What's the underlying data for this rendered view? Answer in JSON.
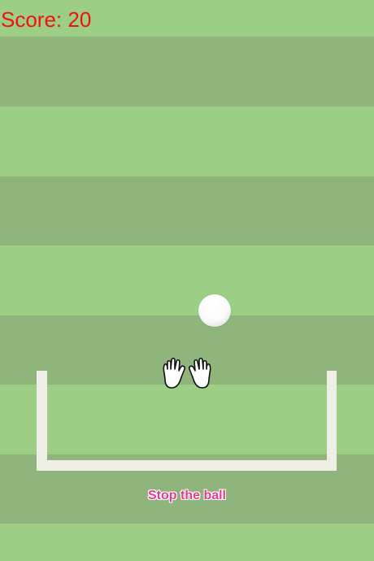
{
  "hud": {
    "score_text": "Score: 20",
    "score_color": "#f2110c"
  },
  "field": {
    "light_color": "#9dce85",
    "dark_color": "#8fb57c"
  },
  "ball": {
    "icon": "soccer-ball-icon",
    "color": "#ffffff"
  },
  "goal": {
    "post_color": "#eeeee6"
  },
  "keeper": {
    "icon": "goalkeeper-gloves-icon"
  },
  "instruction": {
    "text": "Stop the ball",
    "color": "#e23c8e"
  }
}
